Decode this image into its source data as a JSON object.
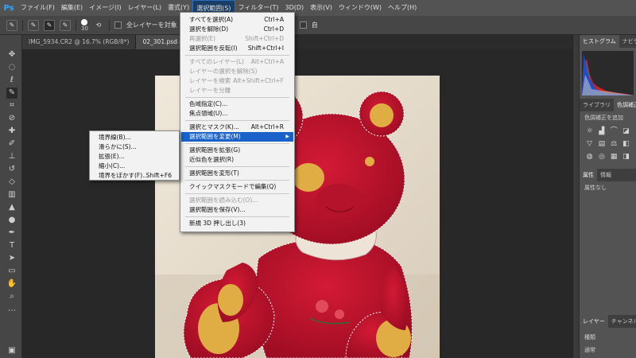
{
  "app": {
    "logo": "Ps"
  },
  "menubar": {
    "items": [
      "ファイル(F)",
      "編集(E)",
      "イメージ(I)",
      "レイヤー(L)",
      "書式(Y)",
      "選択範囲(S)",
      "フィルター(T)",
      "3D(D)",
      "表示(V)",
      "ウィンドウ(W)",
      "ヘルプ(H)"
    ],
    "active_index": 5
  },
  "options_bar": {
    "brush_size": "30",
    "sample_all_layers": "全レイヤーを対象",
    "auto_enhance_partial": "自"
  },
  "tabs": [
    "IMG_5934.CR2 @ 16.7% (RGB/8*)",
    "02_301.psd @ 6"
  ],
  "select_menu": {
    "items": [
      {
        "label": "すべてを選択(A)",
        "shortcut": "Ctrl+A",
        "disabled": false
      },
      {
        "label": "選択を解除(D)",
        "shortcut": "Ctrl+D",
        "disabled": false
      },
      {
        "label": "再選択(E)",
        "shortcut": "Shift+Ctrl+D",
        "disabled": true
      },
      {
        "label": "選択範囲を反転(I)",
        "shortcut": "Shift+Ctrl+I",
        "disabled": false
      },
      {
        "label": "すべてのレイヤー(L)",
        "shortcut": "Alt+Ctrl+A",
        "disabled": true
      },
      {
        "label": "レイヤーの選択を解除(S)",
        "shortcut": "",
        "disabled": true
      },
      {
        "label": "レイヤーを検索",
        "shortcut": "Alt+Shift+Ctrl+F",
        "disabled": true
      },
      {
        "label": "レイヤーを分離",
        "shortcut": "",
        "disabled": true
      },
      {
        "label": "色域指定(C)...",
        "shortcut": "",
        "disabled": false
      },
      {
        "label": "焦点領域(U)...",
        "shortcut": "",
        "disabled": false
      },
      {
        "label": "選択とマスク(K)...",
        "shortcut": "Alt+Ctrl+R",
        "disabled": false
      },
      {
        "label": "選択範囲を変更(M)",
        "shortcut": "",
        "disabled": false,
        "highlighted": true
      },
      {
        "label": "選択範囲を拡張(G)",
        "shortcut": "",
        "disabled": false
      },
      {
        "label": "近似色を選択(R)",
        "shortcut": "",
        "disabled": false
      },
      {
        "label": "選択範囲を変形(T)",
        "shortcut": "",
        "disabled": false
      },
      {
        "label": "クイックマスクモードで編集(Q)",
        "shortcut": "",
        "disabled": false
      },
      {
        "label": "選択範囲を読み込む(O)...",
        "shortcut": "",
        "disabled": true
      },
      {
        "label": "選択範囲を保存(V)...",
        "shortcut": "",
        "disabled": false
      },
      {
        "label": "新規 3D 押し出し(3)",
        "shortcut": "",
        "disabled": false
      }
    ]
  },
  "modify_submenu": {
    "items": [
      {
        "label": "境界線(B)...",
        "shortcut": ""
      },
      {
        "label": "滑らかに(S)...",
        "shortcut": ""
      },
      {
        "label": "拡張(E)...",
        "shortcut": ""
      },
      {
        "label": "縮小(C)...",
        "shortcut": ""
      },
      {
        "label": "境界をぼかす(F)...",
        "shortcut": "Shift+F6"
      }
    ]
  },
  "right_panels": {
    "histogram_tabs": [
      "ヒストグラム",
      "ナビゲー"
    ],
    "library_tabs": [
      "ライブラリ",
      "色調補正"
    ],
    "adjustments_title": "色調補正を追加",
    "properties_tabs": [
      "属性",
      "情報"
    ],
    "properties_text": "属性なし",
    "layers_tabs": [
      "レイヤー",
      "チャンネル"
    ],
    "layers_filter": "種類",
    "layers_blend": "通常"
  },
  "colors": {
    "menubar_bg": "#535353",
    "menu_highlight": "#1a62c9",
    "bear_red": "#c8102e",
    "patch_yellow": "#e6b84a",
    "photo_bg": "#e9e0d2"
  }
}
